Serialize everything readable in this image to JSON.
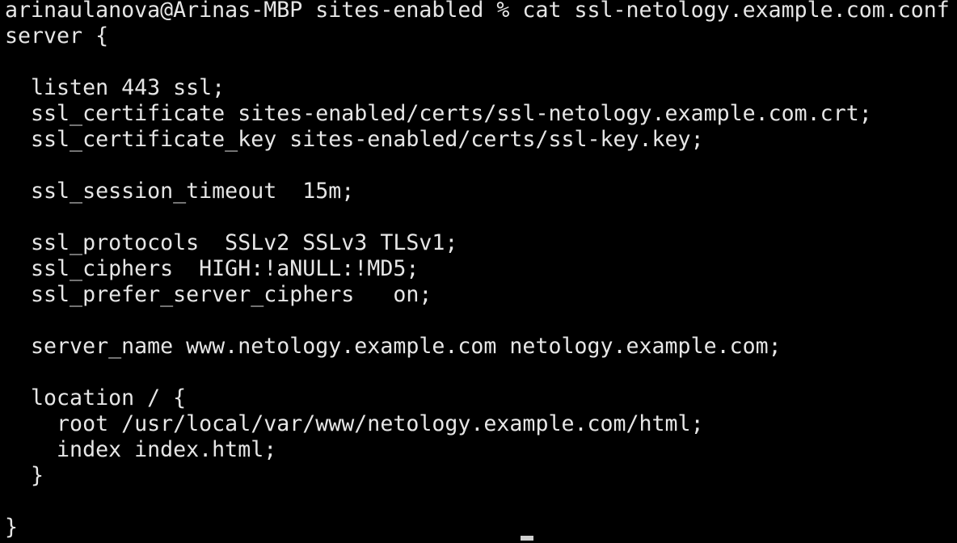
{
  "terminal": {
    "background": "#000000",
    "foreground": "#e6e6e6",
    "lines": [
      "arinaulanova@Arinas-MBP sites-enabled % cat ssl-netology.example.com.conf",
      "server {",
      "",
      "  listen 443 ssl;",
      "  ssl_certificate sites-enabled/certs/ssl-netology.example.com.crt;",
      "  ssl_certificate_key sites-enabled/certs/ssl-key.key;",
      "",
      "  ssl_session_timeout  15m;",
      "",
      "  ssl_protocols  SSLv2 SSLv3 TLSv1;",
      "  ssl_ciphers  HIGH:!aNULL:!MD5;",
      "  ssl_prefer_server_ciphers   on;",
      "",
      "  server_name www.netology.example.com netology.example.com;",
      "",
      "  location / {",
      "    root /usr/local/var/www/netology.example.com/html;",
      "    index index.html;",
      "  }",
      "",
      "}"
    ]
  }
}
